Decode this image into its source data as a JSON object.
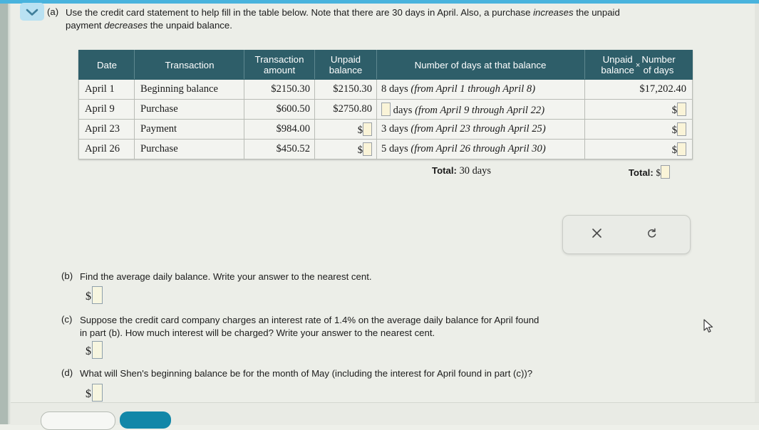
{
  "colors": {
    "header_bg": "#2e5e69",
    "accent_blue": "#49b3dd",
    "teal_button": "#1287a8",
    "input_fill": "#faf4d8",
    "page_bg": "#eceee8"
  },
  "chevron": {
    "icon": "chevron-down-icon"
  },
  "parts": {
    "a": {
      "label": "(a)",
      "text_1": "Use the credit card statement to help fill in the table below. Note that there are 30 days in April. Also, a purchase ",
      "em_1": "increases",
      "text_2": " the unpaid",
      "text_3": "payment ",
      "em_2": "decreases",
      "text_4": " the unpaid balance."
    },
    "b": {
      "label": "(b)",
      "text": "Find the average daily balance. Write your answer to the nearest cent.",
      "answer_prefix": "$",
      "answer_value": ""
    },
    "c": {
      "label": "(c)",
      "text_line1": "Suppose the credit card company charges an interest rate of 1.4% on the average daily balance for April found",
      "text_line2": "in part (b). How much interest will be charged? Write your answer to the nearest cent.",
      "answer_prefix": "$",
      "answer_value": ""
    },
    "d": {
      "label": "(d)",
      "text": "What will Shen's beginning balance be for the month of May (including the interest for April found in part (c))?",
      "answer_prefix": "$",
      "answer_value": ""
    }
  },
  "table": {
    "headers": {
      "date": "Date",
      "transaction": "Transaction",
      "amount_line1": "Transaction",
      "amount_line2": "amount",
      "balance_line1": "Unpaid",
      "balance_line2": "balance",
      "days": "Number of days at that balance",
      "product_left_line1": "Unpaid",
      "product_left_line2": "balance",
      "product_times": "×",
      "product_right_line1": "Number",
      "product_right_line2": "of days"
    },
    "rows": [
      {
        "date": "April 1",
        "transaction": "Beginning balance",
        "amount": "$2150.30",
        "balance": "$2150.30",
        "balance_is_input": false,
        "days_count": "8",
        "days_count_is_input": false,
        "days_word": " days ",
        "days_range": "(from April 1 through April 8)",
        "product": "$17,202.40",
        "product_is_input": false
      },
      {
        "date": "April 9",
        "transaction": "Purchase",
        "amount": "$600.50",
        "balance": "$2750.80",
        "balance_is_input": false,
        "days_count": "",
        "days_count_is_input": true,
        "days_word": " days ",
        "days_range": "(from April 9 through April 22)",
        "product": "$",
        "product_is_input": true
      },
      {
        "date": "April 23",
        "transaction": "Payment",
        "amount": "$984.00",
        "balance": "$",
        "balance_is_input": true,
        "days_count": "3",
        "days_count_is_input": false,
        "days_word": " days ",
        "days_range": "(from April 23 through April 25)",
        "product": "$",
        "product_is_input": true
      },
      {
        "date": "April 26",
        "transaction": "Purchase",
        "amount": "$450.52",
        "balance": "$",
        "balance_is_input": true,
        "days_count": "5",
        "days_count_is_input": false,
        "days_word": " days ",
        "days_range": "(from April 26 through April 30)",
        "product": "$",
        "product_is_input": true
      }
    ],
    "totals": {
      "days_label": "Total:",
      "days_value": "30 days",
      "product_label": "Total:",
      "product_prefix": "$",
      "product_value": ""
    }
  },
  "tool_panel": {
    "clear_icon": "close-x-icon",
    "undo_icon": "undo-arrow-icon"
  },
  "footer": {
    "secondary_button": "",
    "primary_button": ""
  }
}
